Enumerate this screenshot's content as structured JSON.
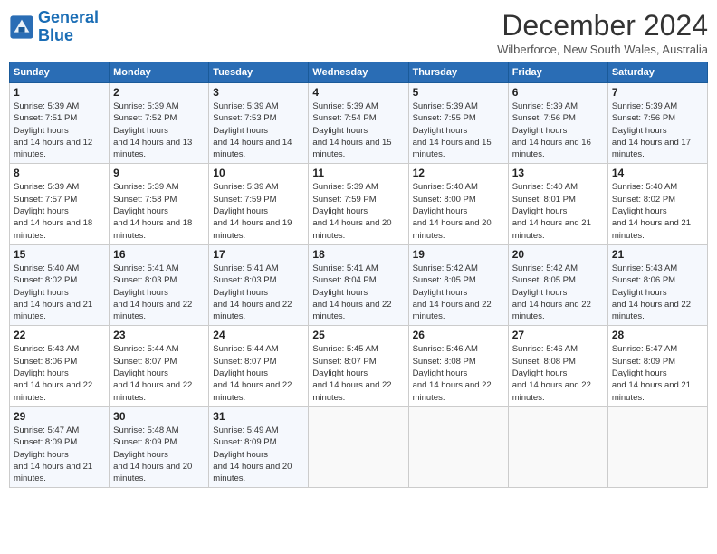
{
  "header": {
    "logo_line1": "General",
    "logo_line2": "Blue",
    "month_year": "December 2024",
    "location": "Wilberforce, New South Wales, Australia"
  },
  "weekdays": [
    "Sunday",
    "Monday",
    "Tuesday",
    "Wednesday",
    "Thursday",
    "Friday",
    "Saturday"
  ],
  "weeks": [
    [
      {
        "day": "1",
        "sunrise": "5:39 AM",
        "sunset": "7:51 PM",
        "daylight": "14 hours and 12 minutes."
      },
      {
        "day": "2",
        "sunrise": "5:39 AM",
        "sunset": "7:52 PM",
        "daylight": "14 hours and 13 minutes."
      },
      {
        "day": "3",
        "sunrise": "5:39 AM",
        "sunset": "7:53 PM",
        "daylight": "14 hours and 14 minutes."
      },
      {
        "day": "4",
        "sunrise": "5:39 AM",
        "sunset": "7:54 PM",
        "daylight": "14 hours and 15 minutes."
      },
      {
        "day": "5",
        "sunrise": "5:39 AM",
        "sunset": "7:55 PM",
        "daylight": "14 hours and 15 minutes."
      },
      {
        "day": "6",
        "sunrise": "5:39 AM",
        "sunset": "7:56 PM",
        "daylight": "14 hours and 16 minutes."
      },
      {
        "day": "7",
        "sunrise": "5:39 AM",
        "sunset": "7:56 PM",
        "daylight": "14 hours and 17 minutes."
      }
    ],
    [
      {
        "day": "8",
        "sunrise": "5:39 AM",
        "sunset": "7:57 PM",
        "daylight": "14 hours and 18 minutes."
      },
      {
        "day": "9",
        "sunrise": "5:39 AM",
        "sunset": "7:58 PM",
        "daylight": "14 hours and 18 minutes."
      },
      {
        "day": "10",
        "sunrise": "5:39 AM",
        "sunset": "7:59 PM",
        "daylight": "14 hours and 19 minutes."
      },
      {
        "day": "11",
        "sunrise": "5:39 AM",
        "sunset": "7:59 PM",
        "daylight": "14 hours and 20 minutes."
      },
      {
        "day": "12",
        "sunrise": "5:40 AM",
        "sunset": "8:00 PM",
        "daylight": "14 hours and 20 minutes."
      },
      {
        "day": "13",
        "sunrise": "5:40 AM",
        "sunset": "8:01 PM",
        "daylight": "14 hours and 21 minutes."
      },
      {
        "day": "14",
        "sunrise": "5:40 AM",
        "sunset": "8:02 PM",
        "daylight": "14 hours and 21 minutes."
      }
    ],
    [
      {
        "day": "15",
        "sunrise": "5:40 AM",
        "sunset": "8:02 PM",
        "daylight": "14 hours and 21 minutes."
      },
      {
        "day": "16",
        "sunrise": "5:41 AM",
        "sunset": "8:03 PM",
        "daylight": "14 hours and 22 minutes."
      },
      {
        "day": "17",
        "sunrise": "5:41 AM",
        "sunset": "8:03 PM",
        "daylight": "14 hours and 22 minutes."
      },
      {
        "day": "18",
        "sunrise": "5:41 AM",
        "sunset": "8:04 PM",
        "daylight": "14 hours and 22 minutes."
      },
      {
        "day": "19",
        "sunrise": "5:42 AM",
        "sunset": "8:05 PM",
        "daylight": "14 hours and 22 minutes."
      },
      {
        "day": "20",
        "sunrise": "5:42 AM",
        "sunset": "8:05 PM",
        "daylight": "14 hours and 22 minutes."
      },
      {
        "day": "21",
        "sunrise": "5:43 AM",
        "sunset": "8:06 PM",
        "daylight": "14 hours and 22 minutes."
      }
    ],
    [
      {
        "day": "22",
        "sunrise": "5:43 AM",
        "sunset": "8:06 PM",
        "daylight": "14 hours and 22 minutes."
      },
      {
        "day": "23",
        "sunrise": "5:44 AM",
        "sunset": "8:07 PM",
        "daylight": "14 hours and 22 minutes."
      },
      {
        "day": "24",
        "sunrise": "5:44 AM",
        "sunset": "8:07 PM",
        "daylight": "14 hours and 22 minutes."
      },
      {
        "day": "25",
        "sunrise": "5:45 AM",
        "sunset": "8:07 PM",
        "daylight": "14 hours and 22 minutes."
      },
      {
        "day": "26",
        "sunrise": "5:46 AM",
        "sunset": "8:08 PM",
        "daylight": "14 hours and 22 minutes."
      },
      {
        "day": "27",
        "sunrise": "5:46 AM",
        "sunset": "8:08 PM",
        "daylight": "14 hours and 22 minutes."
      },
      {
        "day": "28",
        "sunrise": "5:47 AM",
        "sunset": "8:09 PM",
        "daylight": "14 hours and 21 minutes."
      }
    ],
    [
      {
        "day": "29",
        "sunrise": "5:47 AM",
        "sunset": "8:09 PM",
        "daylight": "14 hours and 21 minutes."
      },
      {
        "day": "30",
        "sunrise": "5:48 AM",
        "sunset": "8:09 PM",
        "daylight": "14 hours and 20 minutes."
      },
      {
        "day": "31",
        "sunrise": "5:49 AM",
        "sunset": "8:09 PM",
        "daylight": "14 hours and 20 minutes."
      },
      null,
      null,
      null,
      null
    ]
  ]
}
